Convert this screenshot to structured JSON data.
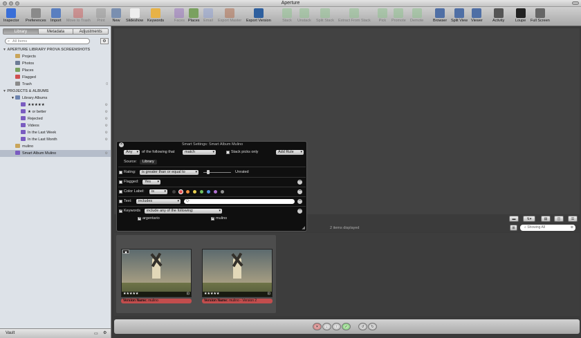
{
  "window": {
    "title": "Aperture"
  },
  "toolbar": [
    {
      "label": "Inspector",
      "icon": "info-icon",
      "color": "#3a6fd8",
      "disabled": false
    },
    {
      "label": "Preferences",
      "icon": "switch-icon",
      "color": "#8a8a8a",
      "disabled": false
    },
    {
      "label": "Import",
      "icon": "import-arrow-icon",
      "color": "#5a7fc0",
      "disabled": false
    },
    {
      "label": "Move to Trash",
      "icon": "no-entry-icon",
      "color": "#c66",
      "disabled": true
    },
    {
      "label": "Print",
      "icon": "printer-icon",
      "color": "#999",
      "disabled": true
    },
    {
      "label": "New",
      "icon": "new-album-icon",
      "color": "#7a8fb0",
      "disabled": false
    },
    {
      "label": "Slideshow",
      "icon": "play-icon",
      "color": "#eee",
      "disabled": false
    },
    {
      "label": "Keywords",
      "icon": "tag-icon",
      "color": "#e7b247",
      "disabled": false
    },
    {
      "label": "Faces",
      "icon": "faces-icon",
      "color": "#9a77c0",
      "disabled": true
    },
    {
      "label": "Places",
      "icon": "map-icon",
      "color": "#7aa160",
      "disabled": false
    },
    {
      "label": "Email",
      "icon": "email-icon",
      "color": "#8fa0d0",
      "disabled": true
    },
    {
      "label": "Export Master",
      "icon": "export-master-icon",
      "color": "#b07050",
      "disabled": true
    },
    {
      "label": "Export Version",
      "icon": "export-version-icon",
      "color": "#2e5f9e",
      "disabled": false
    },
    {
      "label": "Stack",
      "icon": "stack-icon",
      "color": "#8fc190",
      "disabled": true
    },
    {
      "label": "Unstack",
      "icon": "unstack-icon",
      "color": "#8fc190",
      "disabled": true
    },
    {
      "label": "Split Stack",
      "icon": "split-stack-icon",
      "color": "#8fc190",
      "disabled": true
    },
    {
      "label": "Extract From Stack",
      "icon": "extract-stack-icon",
      "color": "#8fc190",
      "disabled": true
    },
    {
      "label": "Pick",
      "icon": "pick-icon",
      "color": "#8fc190",
      "disabled": true
    },
    {
      "label": "Promote",
      "icon": "promote-icon",
      "color": "#8fc190",
      "disabled": true
    },
    {
      "label": "Demote",
      "icon": "demote-icon",
      "color": "#8fc190",
      "disabled": true
    },
    {
      "label": "Browser",
      "icon": "browser-icon",
      "color": "#4f6fa5",
      "disabled": false
    },
    {
      "label": "Split View",
      "icon": "split-view-icon",
      "color": "#4f6fa5",
      "disabled": false
    },
    {
      "label": "Viewer",
      "icon": "viewer-icon",
      "color": "#4f6fa5",
      "disabled": false
    },
    {
      "label": "Activity",
      "icon": "activity-icon",
      "color": "#555",
      "disabled": false
    },
    {
      "label": "Loupe",
      "icon": "loupe-icon",
      "color": "#222",
      "disabled": false
    },
    {
      "label": "Full Screen",
      "icon": "full-screen-icon",
      "color": "#666",
      "disabled": false
    }
  ],
  "sidebar": {
    "tabs": [
      {
        "label": "Library",
        "active": true
      },
      {
        "label": "Metadata",
        "active": false
      },
      {
        "label": "Adjustments",
        "active": false
      }
    ],
    "search_placeholder": "All Items",
    "items": [
      {
        "label": "APERTURE LIBRARY PROVA SCREENSHOTS",
        "type": "section",
        "indent": 0,
        "disclosure": "▼"
      },
      {
        "label": "Projects",
        "type": "item",
        "indent": 1,
        "icon": "projects-icon",
        "color": "#c9a55a"
      },
      {
        "label": "Photos",
        "type": "item",
        "indent": 1,
        "icon": "photos-icon",
        "color": "#6d7c96"
      },
      {
        "label": "Places",
        "type": "item",
        "indent": 1,
        "icon": "places-icon",
        "color": "#7aa160"
      },
      {
        "label": "Flagged",
        "type": "item",
        "indent": 1,
        "icon": "flag-icon",
        "color": "#d05050"
      },
      {
        "label": "Trash",
        "type": "item",
        "indent": 1,
        "icon": "trash-icon",
        "color": "#8a8a8a",
        "accessory": "0"
      },
      {
        "label": "PROJECTS & ALBUMS",
        "type": "section",
        "indent": 0,
        "disclosure": "▼"
      },
      {
        "label": "Library Albums",
        "type": "item",
        "indent": 1,
        "icon": "library-albums-icon",
        "color": "#6d84b0",
        "disclosure": "▼"
      },
      {
        "label": "★★★★★",
        "type": "item",
        "indent": 2,
        "icon": "smart-album-icon",
        "color": "#7a5cc0",
        "accessory": "⚙"
      },
      {
        "label": "★ or better",
        "type": "item",
        "indent": 2,
        "icon": "smart-album-icon",
        "color": "#7a5cc0",
        "accessory": "⚙"
      },
      {
        "label": "Rejected",
        "type": "item",
        "indent": 2,
        "icon": "smart-album-icon",
        "color": "#7a5cc0",
        "accessory": "⚙"
      },
      {
        "label": "Videos",
        "type": "item",
        "indent": 2,
        "icon": "smart-album-icon",
        "color": "#7a5cc0",
        "accessory": "⚙"
      },
      {
        "label": "In the Last Week",
        "type": "item",
        "indent": 2,
        "icon": "smart-album-icon",
        "color": "#7a5cc0",
        "accessory": "⚙"
      },
      {
        "label": "In the Last Month",
        "type": "item",
        "indent": 2,
        "icon": "smart-album-icon",
        "color": "#7a5cc0",
        "accessory": "⚙"
      },
      {
        "label": "mulino",
        "type": "item",
        "indent": 1,
        "icon": "project-icon",
        "color": "#c9a55a"
      },
      {
        "label": "Smart Album Mulino",
        "type": "item",
        "indent": 1,
        "icon": "smart-album-icon",
        "color": "#7a5cc0",
        "accessory": "⚙",
        "selected": true
      }
    ],
    "footer_label": "Vault"
  },
  "smart_settings": {
    "title": "Smart Settings: Smart Album Mulino",
    "any_value": "Any",
    "following_text": "of the following that",
    "match_value": "match",
    "stack_picks_label": "Stack picks only",
    "add_rule_label": "Add Rule",
    "source_label": "Source:",
    "source_value": "Library",
    "rating_label": "Rating:",
    "rating_op": "is greater than or equal to",
    "rating_value": "Unrated",
    "flagged_label": "Flagged:",
    "flagged_value": "Yes",
    "color_label": "Color Label:",
    "color_op": "is",
    "color_swatches": [
      "#444444",
      "#e05050",
      "#f09040",
      "#e8d050",
      "#70c060",
      "#5090e0",
      "#b070d0",
      "#909090"
    ],
    "text_label": "Text:",
    "text_op": "includes",
    "text_placeholder": "Q-",
    "keywords_label": "Keywords",
    "keywords_op": "include any of the following:",
    "keywords": [
      "argentario",
      "mulino"
    ]
  },
  "browser": {
    "items_displayed": "2 items displayed",
    "search_value": "Showing All",
    "photos": [
      {
        "name_label": "Version Name:",
        "name_value": "mulino",
        "rating": "★★★★★",
        "badge": "2"
      },
      {
        "name_label": "Version Name:",
        "name_value": "mulino - Version 2",
        "rating": "★★★★★",
        "badge": ""
      }
    ]
  },
  "controls": {
    "buttons": [
      "reject-icon",
      "demote-icon",
      "promote-icon",
      "approve-icon",
      "rotate-left-icon",
      "rotate-right-icon"
    ]
  }
}
